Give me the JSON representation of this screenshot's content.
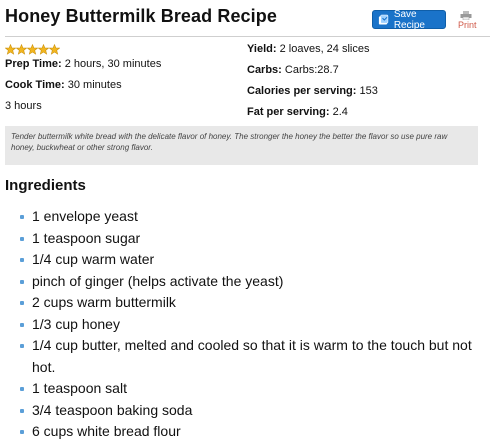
{
  "recipe": {
    "title": "Honey Buttermilk Bread Recipe",
    "save_label": "Save Recipe",
    "print_label": "Print",
    "rating_stars": 5,
    "prep_time_label": "Prep Time:",
    "prep_time_value": " 2 hours, 30 minutes",
    "cook_time_label": "Cook Time:",
    "cook_time_value": " 30 minutes",
    "total_time": "3 hours",
    "yield_label": "Yield:",
    "yield_value": " 2 loaves, 24 slices",
    "carbs_label": "Carbs:",
    "carbs_value": " Carbs:28.7",
    "calories_label": "Calories per serving:",
    "calories_value": " 153",
    "fat_label": "Fat per serving:",
    "fat_value": " 2.4",
    "description": "Tender buttermilk white bread with the delicate flavor of honey. The stronger the honey the better the flavor so use pure raw honey, buckwheat or other strong flavor.",
    "ingredients_heading": "Ingredients",
    "ingredients": [
      "1 envelope yeast",
      "1 teaspoon sugar",
      "1/4 cup warm water",
      "pinch of ginger (helps activate the yeast)",
      "2 cups warm buttermilk",
      "1/3 cup honey",
      "1/4 cup butter, melted and cooled so that it is warm to the touch but not hot.",
      "1 teaspoon salt",
      "3/4 teaspoon baking soda",
      "6 cups white bread flour"
    ]
  },
  "colors": {
    "save_button": "#1a73c9",
    "print_link": "#d05a4a",
    "star": "#f2b61f",
    "bullet": "#5b9fd8",
    "description_bg": "#e8e8e8"
  },
  "icons": {
    "save": "recipe-card-icon",
    "print": "printer-icon",
    "rating": "star-icon",
    "bullet": "square-bullet-icon"
  }
}
